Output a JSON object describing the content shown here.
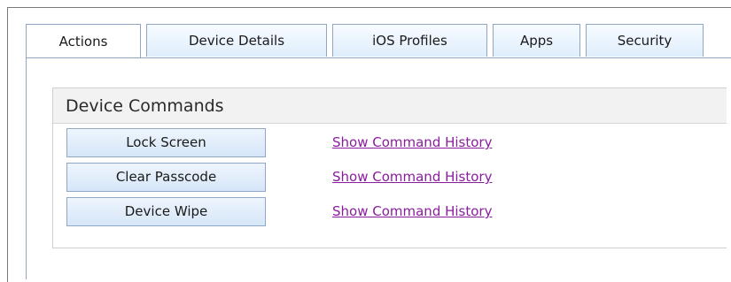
{
  "tabs": [
    {
      "label": "Actions",
      "active": true
    },
    {
      "label": "Device Details",
      "active": false
    },
    {
      "label": "iOS Profiles",
      "active": false
    },
    {
      "label": "Apps",
      "active": false
    },
    {
      "label": "Security",
      "active": false
    }
  ],
  "panel": {
    "title": "Device Commands",
    "commands": [
      {
        "button_label": "Lock Screen",
        "link_label": "Show Command History"
      },
      {
        "button_label": "Clear Passcode",
        "link_label": "Show Command History"
      },
      {
        "button_label": "Device Wipe",
        "link_label": "Show Command History"
      }
    ]
  },
  "colors": {
    "tab_border": "#8fa7c2",
    "button_gradient_top": "#eef5fd",
    "button_gradient_bottom": "#d6e6f8",
    "link": "#8a1c9e",
    "panel_header_bg": "#f2f2f2"
  }
}
